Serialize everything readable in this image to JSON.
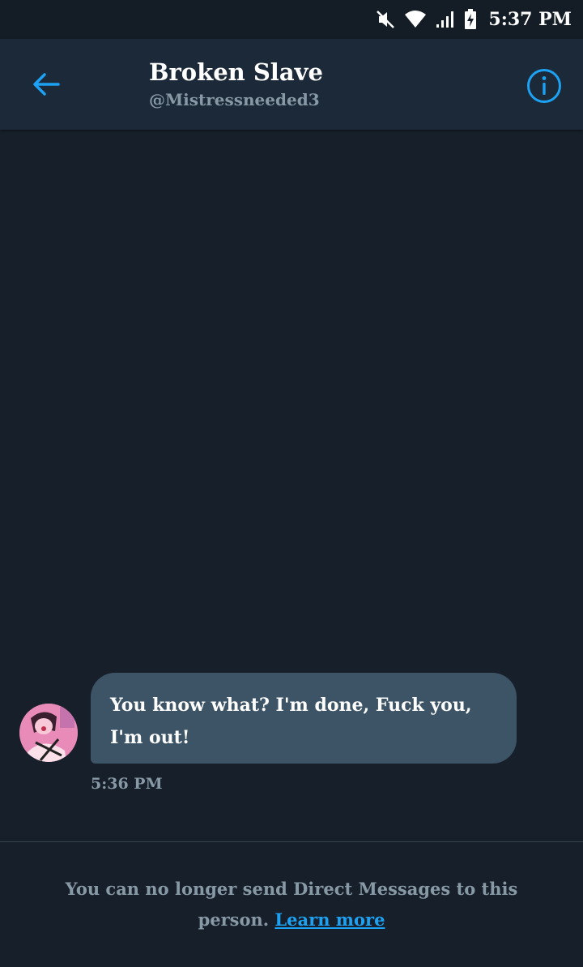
{
  "status_bar": {
    "time": "5:37 PM",
    "icons": [
      "muted-icon",
      "wifi-icon",
      "signal-icon",
      "battery-charging-icon"
    ]
  },
  "header": {
    "display_name": "Broken Slave",
    "handle": "@Mistressneeded3",
    "icons": [
      "back-arrow-icon",
      "info-icon"
    ]
  },
  "message": {
    "lines": [
      "You know what? I'm done, Fuck you,",
      "I'm out!"
    ],
    "timestamp": "5:36 PM"
  },
  "notice": {
    "text": "You can no longer send Direct Messages to this person.",
    "link_label": "Learn more"
  },
  "colors": {
    "background": "#17202a",
    "header": "#1c2938",
    "bubble": "#3d5466",
    "accent": "#1da1f2",
    "secondary_text": "#8899a6"
  }
}
